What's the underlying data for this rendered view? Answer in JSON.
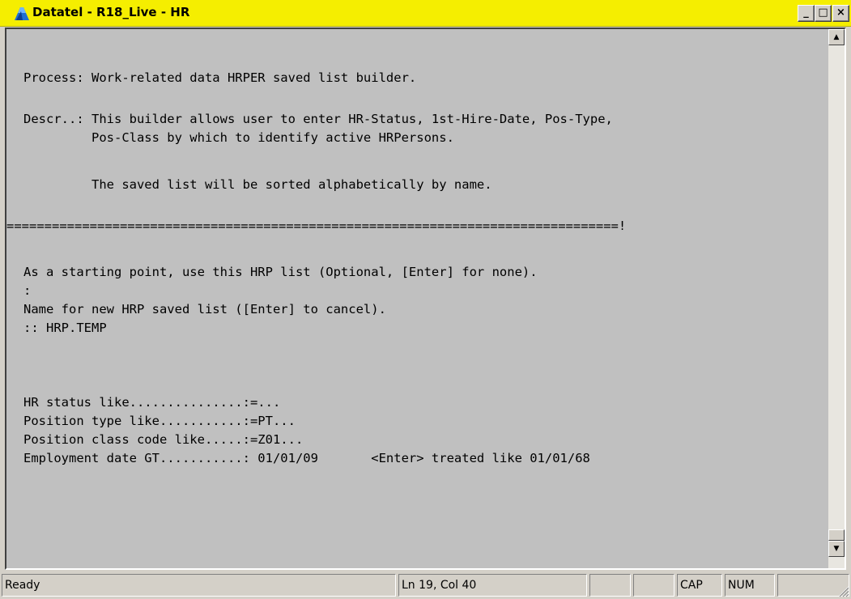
{
  "window": {
    "title": "Datatel - R18_Live - HR",
    "minimize_glyph": "_",
    "maximize_glyph": "□",
    "close_glyph": "×",
    "app_icon": "datatel-app-icon"
  },
  "terminal": {
    "lines": [
      "Process: Work-related data HRPER saved list builder.",
      "Descr..: This builder allows user to enter HR-Status, 1st-Hire-Date, Pos-Type,",
      "         Pos-Class by which to identify active HRPersons.",
      "         The saved list will be sorted alphabetically by name.",
      "=================================================================================!",
      "As a starting point, use this HRP list (Optional, [Enter] for none).",
      ":",
      "Name for new HRP saved list ([Enter] to cancel).",
      ":: HRP.TEMP",
      "HR status like...............:=...",
      "Position type like...........:=PT...",
      "Position class code like.....:=Z01...",
      "Employment date GT...........: 01/01/09       <Enter> treated like 01/01/68"
    ]
  },
  "scrollbar": {
    "up_glyph": "▲",
    "down_glyph": "▼"
  },
  "statusbar": {
    "status": "Ready",
    "position": "Ln 19, Col 40",
    "pane3": "",
    "pane4": "",
    "caps": "CAP",
    "num": "NUM",
    "pane7": ""
  },
  "colors": {
    "titlebar": "#f5ee00",
    "terminal_bg": "#c0c0c0",
    "chrome": "#d4d0c8"
  }
}
